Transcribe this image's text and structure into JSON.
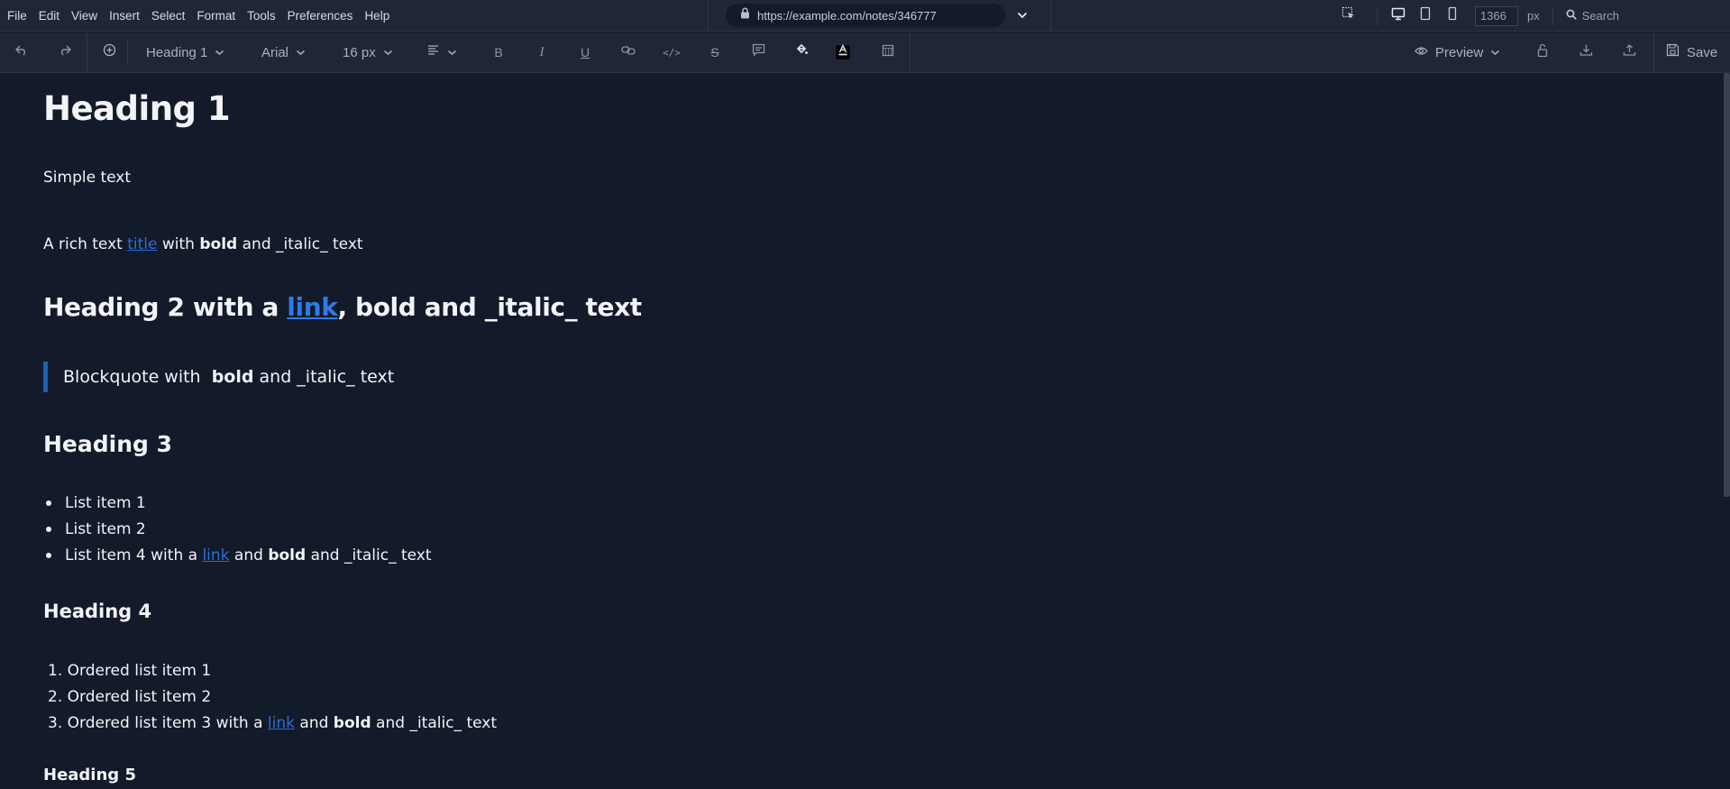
{
  "menubar": {
    "items": [
      "File",
      "Edit",
      "View",
      "Insert",
      "Select",
      "Format",
      "Tools",
      "Preferences",
      "Help"
    ],
    "url": "https://example.com/notes/346777",
    "viewport_width": "1366",
    "px_label": "px",
    "search_placeholder": "Search"
  },
  "toolbar": {
    "block_style": "Heading 1",
    "font_family": "Arial",
    "font_size": "16 px",
    "preview_label": "Preview",
    "save_label": "Save"
  },
  "document": {
    "h1": "Heading 1",
    "simple_text": "Simple text",
    "rich": {
      "before": "A rich text ",
      "link": "title",
      "mid": " with ",
      "bold": "bold",
      "after": " and _italic_ text"
    },
    "h2": {
      "before": "Heading 2 with a ",
      "link": "link",
      "comma": ", ",
      "bold": "bold",
      "after": " and _italic_ text"
    },
    "blockquote": {
      "before": "Blockquote with ",
      "bold": "bold",
      "after": " and _italic_ text"
    },
    "h3": "Heading 3",
    "unordered": {
      "item1": "List item 1",
      "item2": "List item 2",
      "item3": {
        "before": "List item 4 with a ",
        "link": "link",
        "mid": " and ",
        "bold": "bold",
        "after": " and _italic_ text"
      }
    },
    "h4": "Heading 4",
    "ordered": {
      "item1": "1. Ordered list item 1",
      "item2": "2. Ordered list item 2",
      "item3": {
        "before": "3. Ordered list item 3 with a ",
        "link": "link",
        "mid": " and ",
        "bold": "bold",
        "after": " and _italic_ text"
      }
    },
    "h5": "Heading 5"
  },
  "colors": {
    "link": "#2a6fd6",
    "blockquote_bar": "#1f5fb5",
    "background": "#131a29",
    "chrome": "#1f2737"
  }
}
